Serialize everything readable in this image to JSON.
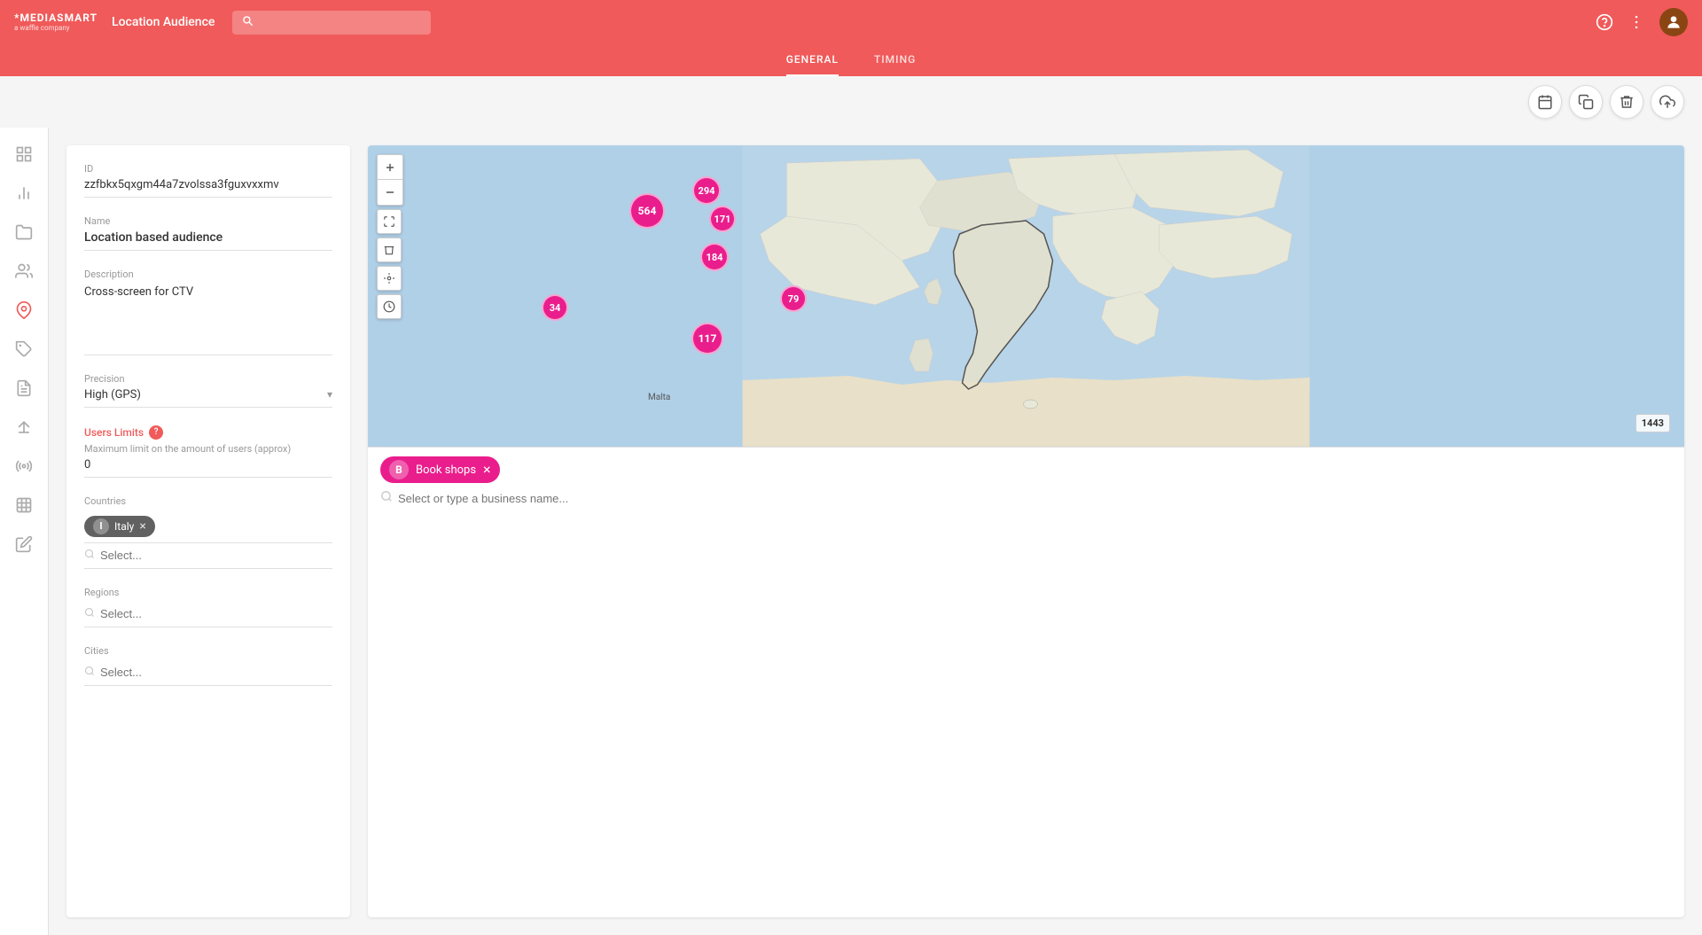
{
  "app": {
    "logo_line1": "*MEDIASMART",
    "logo_line2": "a waffle company",
    "header_title": "Location Audience",
    "search_placeholder": "",
    "tabs": [
      {
        "id": "general",
        "label": "GENERAL",
        "active": true
      },
      {
        "id": "timing",
        "label": "TIMING",
        "active": false
      }
    ]
  },
  "action_buttons": {
    "calendar": "📅",
    "duplicate": "⧉",
    "delete": "🗑",
    "upload": "⬆"
  },
  "sidebar": {
    "icons": [
      {
        "id": "home",
        "symbol": "⊞",
        "active": false
      },
      {
        "id": "chart",
        "symbol": "📊",
        "active": false
      },
      {
        "id": "folder",
        "symbol": "📁",
        "active": false
      },
      {
        "id": "users",
        "symbol": "👥",
        "active": false
      },
      {
        "id": "location",
        "symbol": "📍",
        "active": true
      },
      {
        "id": "tag",
        "symbol": "🏷",
        "active": false
      },
      {
        "id": "report",
        "symbol": "📋",
        "active": false
      },
      {
        "id": "sort",
        "symbol": "⇅",
        "active": false
      },
      {
        "id": "radio",
        "symbol": "📡",
        "active": false
      },
      {
        "id": "grid",
        "symbol": "⊟",
        "active": false
      },
      {
        "id": "edit",
        "symbol": "✏",
        "active": false
      }
    ]
  },
  "left_panel": {
    "id_label": "ID",
    "id_value": "zzfbkx5qxgm44a7zvolssa3fguxvxxmv",
    "name_label": "Name",
    "name_value": "Location based audience",
    "description_label": "Description",
    "description_value": "Cross-screen for CTV",
    "precision_label": "Precision",
    "precision_value": "High (GPS)",
    "users_limits_label": "Users Limits",
    "users_limits_sublabel": "Maximum limit on the amount of users (approx)",
    "users_limits_value": "0",
    "countries_label": "Countries",
    "countries_tag": "Italy",
    "countries_tag_letter": "I",
    "countries_placeholder": "Select...",
    "regions_label": "Regions",
    "regions_placeholder": "Select...",
    "cities_label": "Cities",
    "cities_placeholder": "Select..."
  },
  "map": {
    "clusters": [
      {
        "id": "c1",
        "value": "564",
        "size": "md",
        "left": "52%",
        "top": "18%"
      },
      {
        "id": "c2",
        "value": "294",
        "size": "sm",
        "left": "60%",
        "top": "12%"
      },
      {
        "id": "c3",
        "value": "171",
        "size": "sm",
        "left": "63%",
        "top": "22%"
      },
      {
        "id": "c4",
        "value": "184",
        "size": "sm",
        "left": "62%",
        "top": "31%"
      },
      {
        "id": "c5",
        "value": "34",
        "size": "sm",
        "left": "36%",
        "top": "47%"
      },
      {
        "id": "c6",
        "value": "79",
        "size": "sm",
        "left": "74%",
        "top": "44%"
      },
      {
        "id": "c7",
        "value": "117",
        "size": "md",
        "left": "63%",
        "top": "56%"
      },
      {
        "id": "c8",
        "value": "1443",
        "size": "sm",
        "left": "88%",
        "top": "78%",
        "corner": true
      }
    ]
  },
  "business_bar": {
    "tag_letter": "B",
    "tag_label": "Book shops",
    "search_placeholder": "Select or type a business name..."
  }
}
